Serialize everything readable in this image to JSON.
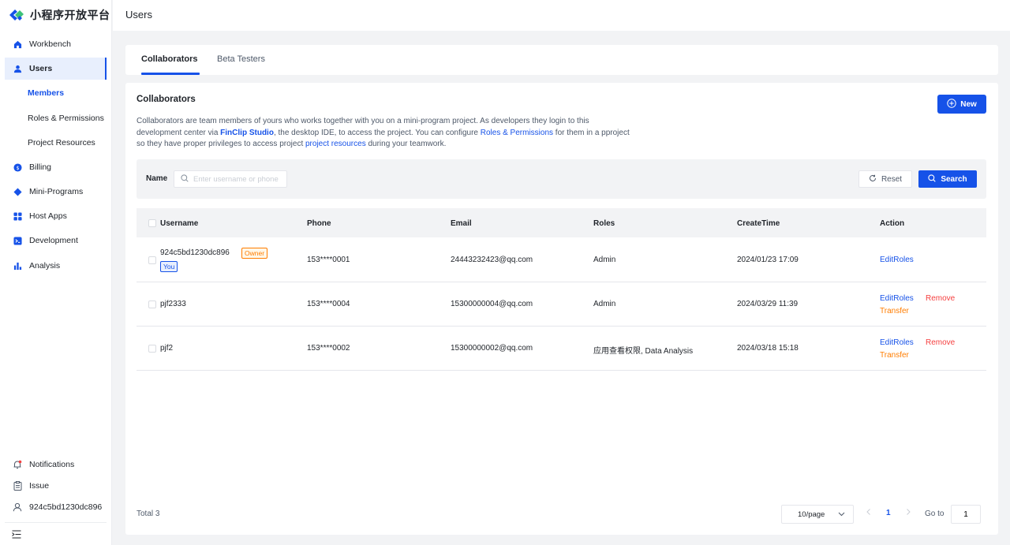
{
  "app": {
    "title": "小程序开放平台"
  },
  "sidebar": {
    "items": [
      {
        "label": "Workbench",
        "icon": "home-icon"
      },
      {
        "label": "Users",
        "icon": "user-icon"
      },
      {
        "label": "Billing",
        "icon": "billing-icon"
      },
      {
        "label": "Mini-Programs",
        "icon": "diamond-icon"
      },
      {
        "label": "Host Apps",
        "icon": "apps-grid-icon"
      },
      {
        "label": "Development",
        "icon": "terminal-icon"
      },
      {
        "label": "Analysis",
        "icon": "bar-chart-icon"
      }
    ],
    "sub_items": [
      {
        "label": "Members"
      },
      {
        "label": "Roles & Permissions"
      },
      {
        "label": "Project Resources"
      }
    ],
    "bottom": [
      {
        "label": "Notifications",
        "icon": "bell-icon"
      },
      {
        "label": "Issue",
        "icon": "clipboard-icon"
      },
      {
        "label": "924c5bd1230dc896",
        "icon": "account-icon"
      }
    ]
  },
  "header": {
    "title": "Users"
  },
  "tabs": [
    {
      "label": "Collaborators"
    },
    {
      "label": "Beta Testers"
    }
  ],
  "collab": {
    "title": "Collaborators",
    "desc_part1": "Collaborators are team members of yours who works together with you on a mini-program project. As developers they login to this development center via ",
    "link_finclip": "FinClip Studio",
    "desc_part2": ", the desktop IDE, to access the project. You can configure ",
    "link_roles": "Roles & Permissions",
    "desc_part3": " for them in a pproject so they have proper privileges to access project ",
    "link_resources": "project resources",
    "desc_part4": " during your teamwork.",
    "new_button": "New"
  },
  "filter": {
    "label": "Name",
    "placeholder": "Enter username or phone",
    "reset": "Reset",
    "search": "Search"
  },
  "table": {
    "columns": [
      "Username",
      "Phone",
      "Email",
      "Roles",
      "CreateTime",
      "Action"
    ],
    "rows": [
      {
        "username": "924c5bd1230dc896",
        "tag_owner": "Owner",
        "tag_you": "You",
        "phone": "153****0001",
        "email": "24443232423@qq.com",
        "roles": "Admin",
        "create_time": "2024/01/23 17:09",
        "edit": "EditRoles"
      },
      {
        "username": "pjf2333",
        "phone": "153****0004",
        "email": "15300000004@qq.com",
        "roles": "Admin",
        "create_time": "2024/03/29 11:39",
        "edit": "EditRoles",
        "remove": "Remove",
        "transfer": "Transfer"
      },
      {
        "username": "pjf2",
        "phone": "153****0002",
        "email": "15300000002@qq.com",
        "roles": "应用查看权限, Data Analysis",
        "create_time": "2024/03/18 15:18",
        "edit": "EditRoles",
        "remove": "Remove",
        "transfer": "Transfer"
      }
    ]
  },
  "pagination": {
    "total": "Total 3",
    "page_size": "10/page",
    "current": "1",
    "goto_label": "Go to",
    "goto_value": "1"
  },
  "colors": {
    "primary": "#1652e8",
    "danger": "#f53f3f",
    "warning": "#ff7d00"
  }
}
